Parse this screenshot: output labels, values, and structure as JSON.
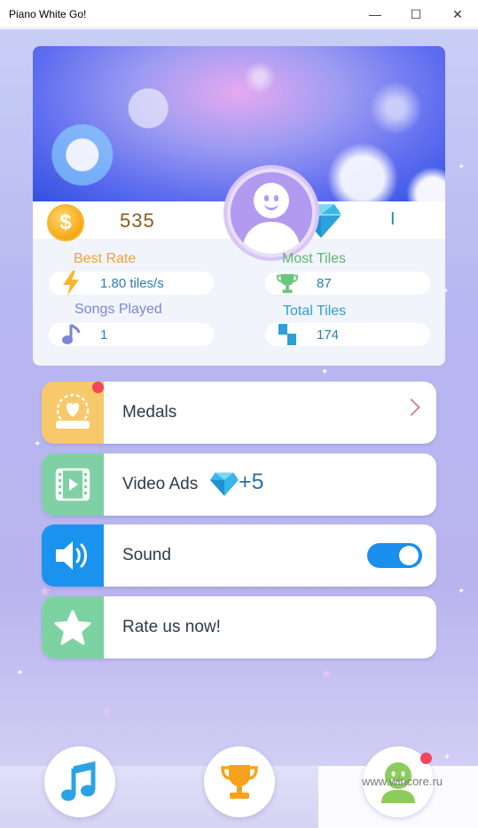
{
  "window": {
    "title": "Piano White Go!",
    "minimize_glyph": "—",
    "maximize_glyph": "☐",
    "close_glyph": "✕"
  },
  "profile": {
    "coins": "535",
    "gems": "I",
    "coin_glyph": "$"
  },
  "stats": {
    "best_rate_label": "Best Rate",
    "best_rate_value": "1.80 tiles/s",
    "most_tiles_label": "Most Tiles",
    "most_tiles_value": "87",
    "songs_played_label": "Songs Played",
    "songs_played_value": "1",
    "total_tiles_label": "Total Tiles",
    "total_tiles_value": "174"
  },
  "menu": {
    "medals": "Medals",
    "video_ads": "Video Ads",
    "video_ads_reward": "+5",
    "sound": "Sound",
    "sound_on": true,
    "rate": "Rate us now!"
  },
  "bottom_nav": [
    "music-note-icon",
    "trophy-icon",
    "profile-icon"
  ],
  "watermark": "www.wincore.ru",
  "colors": {
    "accent_blue": "#1a8ff0",
    "medals": "#f7c96a",
    "video_ads": "#7fd0a4",
    "sound": "#1993ee",
    "rate": "#7cd3a1",
    "badge_red": "#f2465b",
    "best_rate_label": "#f2a13a",
    "most_tiles_label": "#5cb86e",
    "songs_played_label": "#7a86d6",
    "total_tiles_label": "#2c9fd6"
  }
}
